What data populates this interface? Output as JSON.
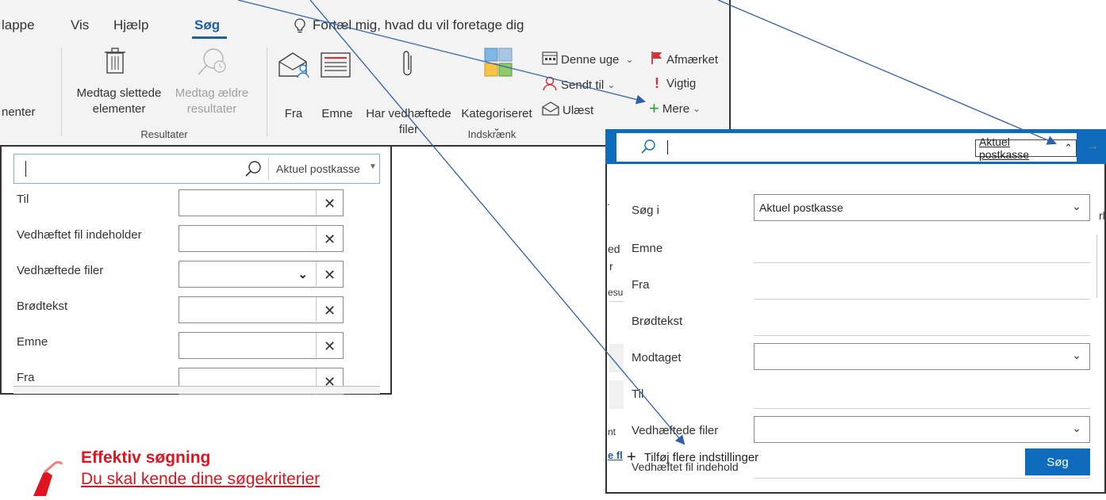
{
  "ribbon": {
    "tabs": [
      {
        "label": "lappe"
      },
      {
        "label": "Vis"
      },
      {
        "label": "Hjælp"
      },
      {
        "label": "Søg",
        "active": true
      }
    ],
    "tell_me": "Fortæl mig, hvad du vil foretage dig",
    "cut_label": "nenter",
    "include_deleted": [
      "Medtag slettede",
      "elementer"
    ],
    "include_older": [
      "Medtag ældre",
      "resultater"
    ],
    "group_results": "Resultater",
    "from": "Fra",
    "subject": "Emne",
    "has_attachments": [
      "Har vedhæftede",
      "filer"
    ],
    "categorized": "Kategoriseret",
    "this_week": "Denne uge",
    "sent_to": "Sendt til",
    "unread": "Ulæst",
    "flagged": "Afmærket",
    "important": "Vigtig",
    "more": "Mere",
    "group_refine": "Indskrænk"
  },
  "left_panel": {
    "scope": "Aktuel postkasse",
    "fields": [
      {
        "label": "Til",
        "dropdown": false
      },
      {
        "label": "Vedhæftet fil indeholder",
        "dropdown": false
      },
      {
        "label": "Vedhæftede filer",
        "dropdown": true
      },
      {
        "label": "Brødtekst",
        "dropdown": false
      },
      {
        "label": "Emne",
        "dropdown": false
      },
      {
        "label": "Fra",
        "dropdown": false
      }
    ]
  },
  "right_panel": {
    "scope": "Aktuel postkasse",
    "search_in_label": "Søg i",
    "search_in_value": "Aktuel postkasse",
    "subject": "Emne",
    "from": "Fra",
    "body": "Brødtekst",
    "received": "Modtaget",
    "to": "Til",
    "attachments": "Vedhæftede filer",
    "attachment_contains": "Vedhæftet fil indehold",
    "add_more": "Tilføj flere indstillinger",
    "search_button": "Søg",
    "behind_fragments": [
      "ed",
      "r",
      "esu",
      "nt",
      "e fl",
      "rl"
    ]
  },
  "caption": {
    "title": "Effektiv søgning",
    "subtitle": "Du skal kende dine søgekriterier"
  },
  "colors": {
    "accent": "#1e5fa6",
    "outlook_blue": "#0f6cbd",
    "caption_red": "#e0141e",
    "arrow": "#2e5fa8"
  }
}
